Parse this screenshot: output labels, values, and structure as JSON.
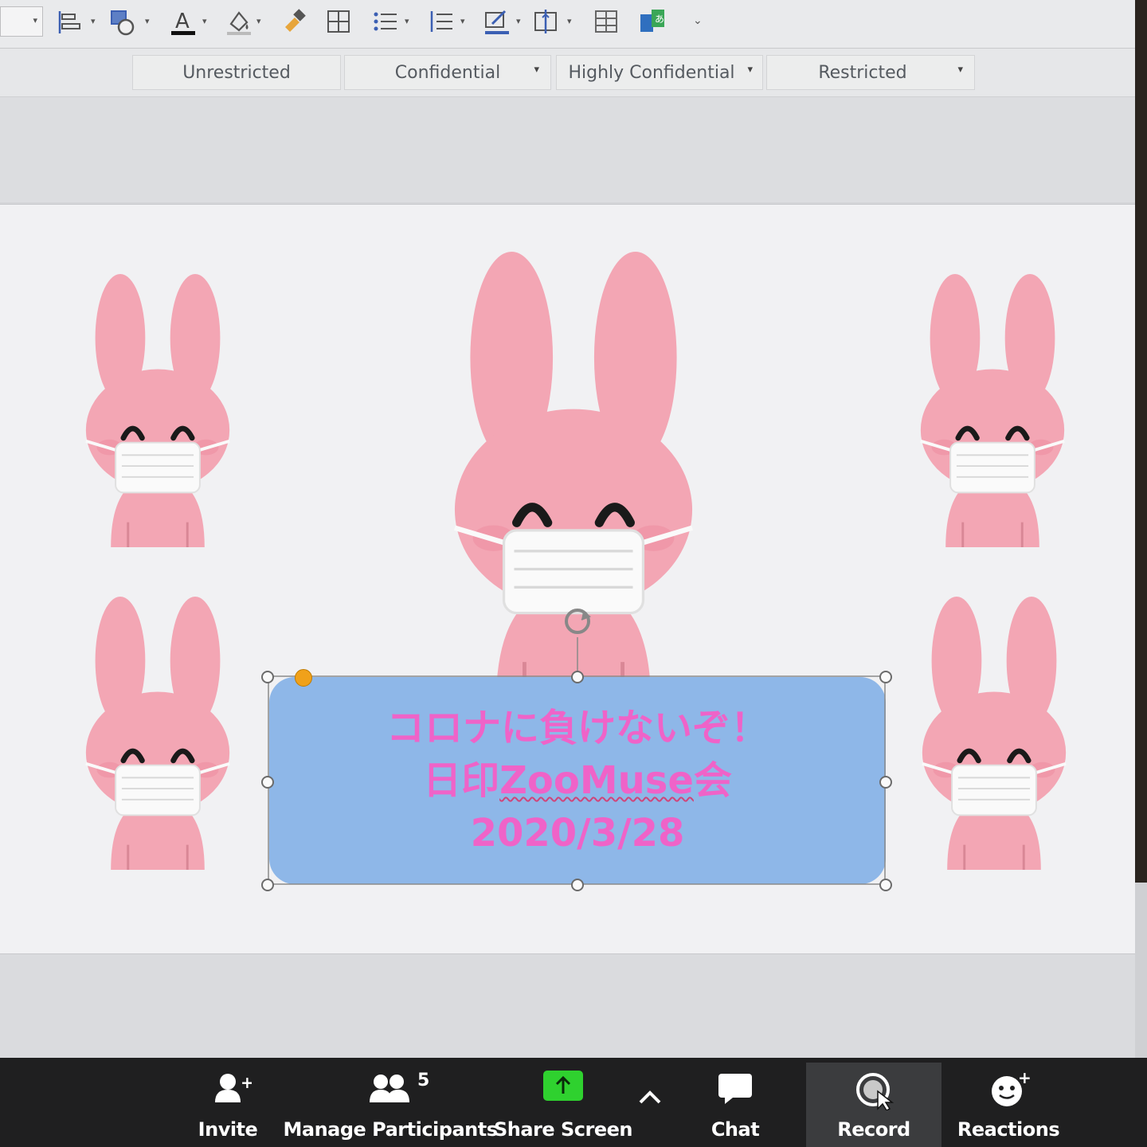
{
  "toolbar": {
    "icons": [
      "align-icon",
      "shape-fill-icon",
      "font-color-icon",
      "fill-color-icon",
      "format-painter-icon",
      "table-icon",
      "bullet-list-icon",
      "numbered-list-icon",
      "highlight-icon",
      "arrange-icon",
      "grid-icon",
      "translate-icon",
      "more-icon"
    ]
  },
  "sensitivity_labels": [
    {
      "label": "Unrestricted",
      "has_dropdown": false
    },
    {
      "label": "Confidential",
      "has_dropdown": true
    },
    {
      "label": "Highly Confidential",
      "has_dropdown": true
    },
    {
      "label": "Restricted",
      "has_dropdown": true
    }
  ],
  "slide": {
    "banner": {
      "line1": "コロナに負けないぞ！",
      "line2_prefix": "日印",
      "line2_word": "ZooMuse",
      "line2_suffix": "会",
      "line3": "2020/3/28",
      "text_color": "#ef63c8",
      "bg_color": "#8eb7e8"
    },
    "characters": [
      "masked-pink-rabbit",
      "masked-pink-rabbit",
      "masked-pink-rabbit",
      "masked-pink-rabbit",
      "masked-pink-rabbit"
    ]
  },
  "zoom_toolbar": {
    "invite": "Invite",
    "manage_participants": "Manage Participants",
    "participant_count": "5",
    "share_screen": "Share Screen",
    "chat": "Chat",
    "record": "Record",
    "reactions": "Reactions",
    "share_color": "#2fd12f"
  }
}
